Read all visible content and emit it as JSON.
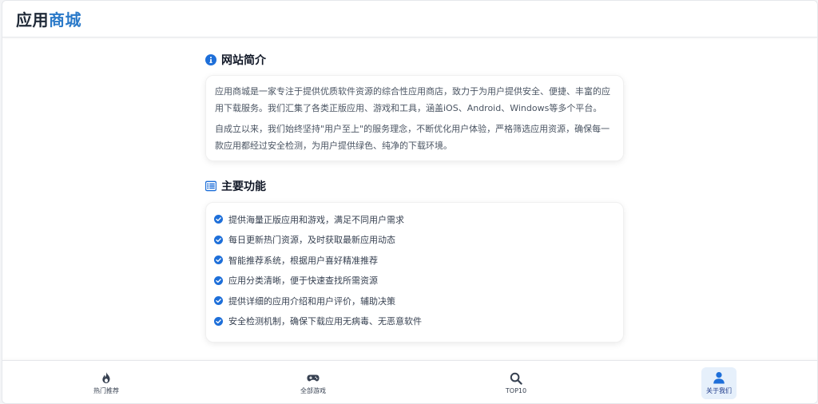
{
  "header": {
    "logo_part1": "应用",
    "logo_part2": "商城"
  },
  "intro": {
    "title": "网站简介",
    "icon": "info-circle-icon",
    "paragraphs": [
      "应用商城是一家专注于提供优质软件资源的综合性应用商店，致力于为用户提供安全、便捷、丰富的应用下载服务。我们汇集了各类正版应用、游戏和工具，涵盖iOS、Android、Windows等多个平台。",
      "自成立以来，我们始终坚持\"用户至上\"的服务理念，不断优化用户体验，严格筛选应用资源，确保每一款应用都经过安全检测，为用户提供绿色、纯净的下载环境。"
    ]
  },
  "features": {
    "title": "主要功能",
    "icon": "list-icon",
    "items": [
      "提供海量正版应用和游戏，满足不同用户需求",
      "每日更新热门资源，及时获取最新应用动态",
      "智能推荐系统，根据用户喜好精准推荐",
      "应用分类清晰，便于快速查找所需资源",
      "提供详细的应用介绍和用户评价，辅助决策",
      "安全检测机制，确保下载应用无病毒、无恶意软件"
    ]
  },
  "bottom_nav": {
    "items": [
      {
        "label": "热门推荐",
        "icon": "fire-icon",
        "active": false
      },
      {
        "label": "全部游戏",
        "icon": "gamepad-icon",
        "active": false
      },
      {
        "label": "TOP10",
        "icon": "search-icon",
        "active": false
      },
      {
        "label": "关于我们",
        "icon": "user-icon",
        "active": true
      }
    ]
  },
  "colors": {
    "brand": "#2b7ac9",
    "accent_blue": "#1e6fd9",
    "active_bg": "#e6f0fb"
  }
}
